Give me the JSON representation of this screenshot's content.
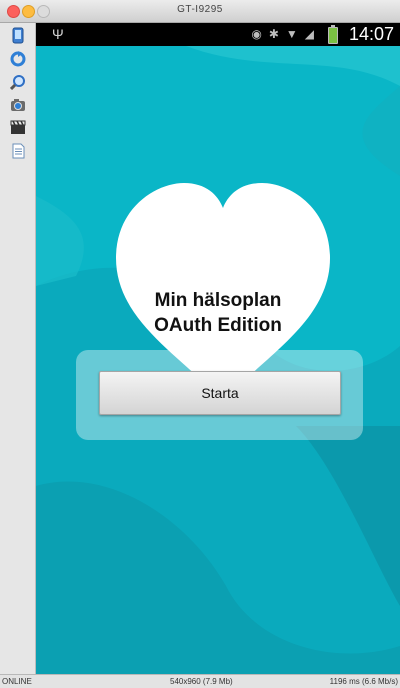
{
  "window": {
    "title": "GT-I9295"
  },
  "toolbar": {
    "icons": [
      "device-icon",
      "rotate-icon",
      "zoom-icon",
      "camera-icon",
      "clapper-icon",
      "document-icon"
    ]
  },
  "statusbar": {
    "usb_glyph": "Ψ",
    "icons": [
      "eye-icon",
      "bluetooth-icon",
      "wifi-icon",
      "signal-icon"
    ],
    "eye_glyph": "◉",
    "bt_glyph": "✱",
    "wifi_glyph": "▼",
    "signal_glyph": "◢",
    "time": "14:07",
    "battery_color": "#7bc043"
  },
  "app": {
    "title_line1": "Min hälsoplan",
    "title_line2": "OAuth Edition",
    "start_button": "Starta",
    "accent": "#08b5c6"
  },
  "bottom": {
    "status": "ONLINE",
    "resolution": "540x960 (7.9 Mb)",
    "timing": "1196 ms (6.6 Mb/s)"
  }
}
